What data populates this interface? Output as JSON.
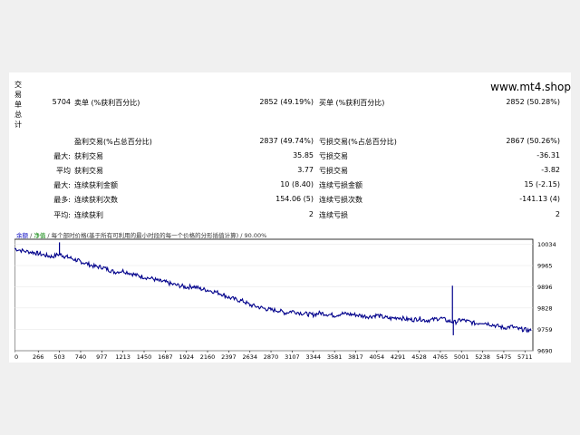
{
  "vertical_label": "交易单总计",
  "site": "www.mt4.shop",
  "rows": [
    {
      "prefix": "5704",
      "label1": "卖单 (%获利百分比)",
      "value1": "2852 (49.19%)",
      "label2": "买单 (%获利百分比)",
      "value2": "2852 (50.28%)"
    },
    {
      "prefix": "",
      "label1": "",
      "value1": "",
      "label2": "",
      "value2": ""
    },
    {
      "prefix": "",
      "label1": "盈利交易(%占总百分比)",
      "value1": "2837 (49.74%)",
      "label2": "亏损交易(%占总百分比)",
      "value2": "2867 (50.26%)"
    },
    {
      "prefix": "最大:",
      "label1": "获利交易",
      "value1": "35.85",
      "label2": "亏损交易",
      "value2": "-36.31"
    },
    {
      "prefix": "平均",
      "label1": "获利交易",
      "value1": "3.77",
      "label2": "亏损交易",
      "value2": "-3.82"
    },
    {
      "prefix": "最大:",
      "label1": "连续获利金额",
      "value1": "10 (8.40)",
      "label2": "连续亏损金额",
      "value2": "15 (-2.15)"
    },
    {
      "prefix": "最多:",
      "label1": "连续获利次数",
      "value1": "154.06 (5)",
      "label2": "连续亏损次数",
      "value2": "-141.13 (4)"
    },
    {
      "prefix": "平均:",
      "label1": "连续获利",
      "value1": "2",
      "label2": "连续亏损",
      "value2": "2"
    }
  ],
  "chart_header": {
    "part1": "余额",
    "sep1": " / ",
    "part2": "净值",
    "rest": " / 每个部时价格(基于所有可利用的最小时段的每一个价格的分形插值计算) / 90.00%"
  },
  "colors": {
    "line": "#00008b",
    "grid": "#e6e6e6",
    "axis": "#000000"
  },
  "chart_data": {
    "type": "line",
    "x_ticks": [
      "0",
      "266",
      "503",
      "740",
      "977",
      "1213",
      "1450",
      "1687",
      "1924",
      "2160",
      "2397",
      "2634",
      "2870",
      "3107",
      "3344",
      "3581",
      "3817",
      "4054",
      "4291",
      "4528",
      "4765",
      "5001",
      "5238",
      "5475",
      "5711"
    ],
    "y_ticks": [
      "10034",
      "9965",
      "9896",
      "9828",
      "9759",
      "9690"
    ],
    "xlim": [
      0,
      5800
    ],
    "ylim": [
      9690,
      10050
    ],
    "series": [
      {
        "values_x": [
          0,
          100,
          200,
          266,
          350,
          420,
          503,
          560,
          620,
          700,
          740,
          820,
          900,
          977,
          1050,
          1120,
          1213,
          1300,
          1380,
          1450,
          1550,
          1620,
          1687,
          1760,
          1850,
          1924,
          2000,
          2080,
          2160,
          2250,
          2330,
          2397,
          2480,
          2560,
          2634,
          2720,
          2800,
          2870,
          2950,
          3030,
          3107,
          3200,
          3280,
          3344,
          3420,
          3500,
          3581,
          3660,
          3740,
          3817,
          3900,
          3980,
          4054,
          4130,
          4210,
          4291,
          4380,
          4460,
          4528,
          4600,
          4680,
          4765,
          4850,
          4930,
          5001,
          5080,
          5160,
          5238,
          5320,
          5400,
          5475,
          5560,
          5640,
          5711,
          5780
        ],
        "values_y": [
          10020,
          10012,
          10008,
          10004,
          9998,
          9994,
          10002,
          9995,
          9990,
          9982,
          9978,
          9970,
          9962,
          9960,
          9952,
          9944,
          9948,
          9940,
          9932,
          9928,
          9922,
          9915,
          9912,
          9905,
          9900,
          9895,
          9898,
          9890,
          9886,
          9880,
          9872,
          9862,
          9855,
          9850,
          9838,
          9832,
          9826,
          9822,
          9820,
          9812,
          9818,
          9812,
          9808,
          9806,
          9812,
          9808,
          9804,
          9810,
          9808,
          9806,
          9802,
          9800,
          9805,
          9798,
          9794,
          9798,
          9792,
          9790,
          9794,
          9788,
          9790,
          9796,
          9786,
          9782,
          9790,
          9784,
          9778,
          9782,
          9776,
          9770,
          9764,
          9768,
          9760,
          9758,
          9754
        ]
      }
    ],
    "spikes": [
      {
        "x": 503,
        "y": 10040
      },
      {
        "x": 4900,
        "y": 9900
      },
      {
        "x": 4910,
        "y": 9740
      }
    ]
  }
}
